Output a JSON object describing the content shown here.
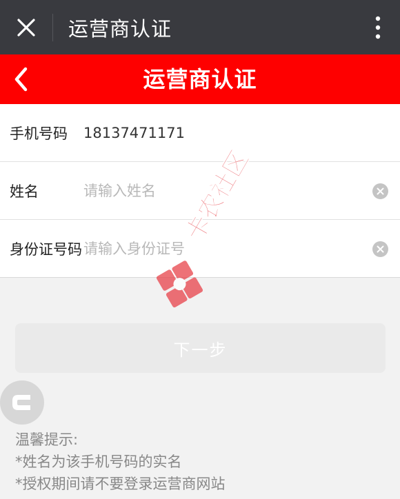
{
  "window": {
    "title": "运营商认证",
    "icons": {
      "close": "close-icon",
      "more": "more-vertical-icon"
    }
  },
  "header": {
    "title": "运营商认证",
    "back_icon": "chevron-left-icon",
    "color": "#fe0000"
  },
  "form": {
    "phone": {
      "label": "手机号码",
      "value": "18137471171"
    },
    "name": {
      "label": "姓名",
      "placeholder": "请输入姓名",
      "value": ""
    },
    "id_number": {
      "label": "身份证号码",
      "placeholder": "请输入身份证号",
      "value": ""
    }
  },
  "next_button": {
    "label": "下一步"
  },
  "tips": {
    "title": "温馨提示:",
    "line1": "*姓名为该手机号码的实名",
    "line2": "*授权期间请不要登录运营商网站"
  },
  "watermark": {
    "text": "卡农社区",
    "color": "#e8434a"
  }
}
